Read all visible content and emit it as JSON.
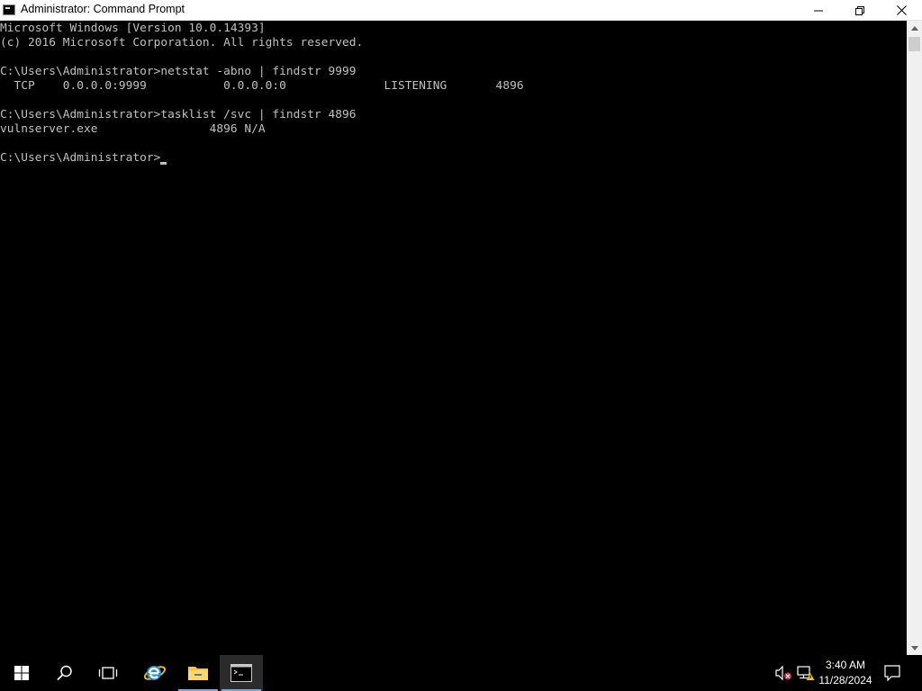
{
  "window": {
    "title": "Administrator: Command Prompt"
  },
  "console": {
    "lines": [
      "Microsoft Windows [Version 10.0.14393]",
      "(c) 2016 Microsoft Corporation. All rights reserved.",
      "",
      "C:\\Users\\Administrator>netstat -abno | findstr 9999",
      "  TCP    0.0.0.0:9999           0.0.0.0:0              LISTENING       4896",
      "",
      "C:\\Users\\Administrator>tasklist /svc | findstr 4896",
      "vulnserver.exe                4896 N/A",
      "",
      "C:\\Users\\Administrator>"
    ],
    "colors": {
      "background": "#000000",
      "text": "#c0c0c0"
    }
  },
  "taskbar": {
    "items": [
      {
        "name": "start",
        "icon": "windows-logo-icon"
      },
      {
        "name": "search",
        "icon": "search-icon"
      },
      {
        "name": "task-view",
        "icon": "task-view-icon"
      },
      {
        "name": "internet-explorer",
        "icon": "internet-explorer-icon"
      },
      {
        "name": "file-explorer",
        "icon": "folder-icon"
      },
      {
        "name": "command-prompt",
        "icon": "command-prompt-icon",
        "active": true
      }
    ],
    "clock": {
      "time": "3:40 AM",
      "date": "11/28/2024"
    },
    "tray_icons": [
      "speaker-muted-icon",
      "network-warning-icon",
      "notification-icon"
    ]
  }
}
